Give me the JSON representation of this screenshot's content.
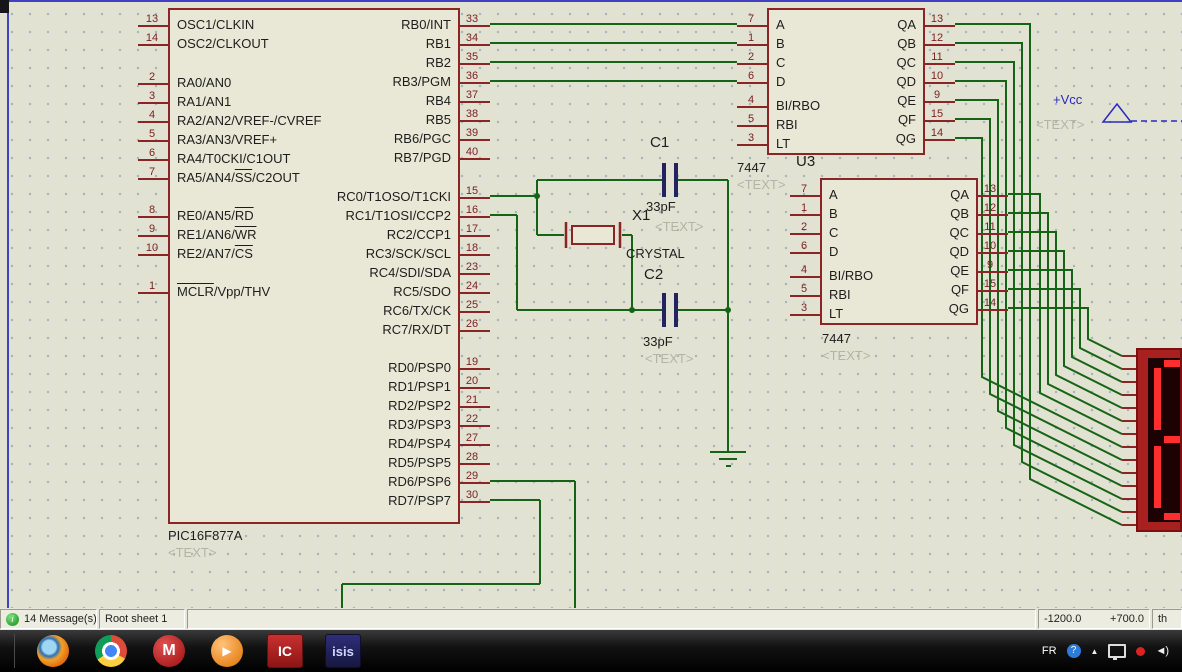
{
  "schematic": {
    "pic": {
      "value": "PIC16F877A",
      "text": "<TEXT>",
      "left_groups": [
        [
          {
            "n": "13",
            "l": [
              {
                "t": "OSC1/CLKIN"
              }
            ]
          },
          {
            "n": "14",
            "l": [
              {
                "t": "OSC2/CLKOUT"
              }
            ]
          }
        ],
        [
          {
            "n": "2",
            "l": [
              {
                "t": "RA0/AN0"
              }
            ]
          },
          {
            "n": "3",
            "l": [
              {
                "t": "RA1/AN1"
              }
            ]
          },
          {
            "n": "4",
            "l": [
              {
                "t": "RA2/AN2/VREF-/CVREF"
              }
            ]
          },
          {
            "n": "5",
            "l": [
              {
                "t": "RA3/AN3/VREF+"
              }
            ]
          },
          {
            "n": "6",
            "l": [
              {
                "t": "RA4/T0CKI/C1OUT"
              }
            ]
          },
          {
            "n": "7",
            "l": [
              {
                "t": "RA5/AN4/"
              },
              {
                "t": "SS",
                "o": true
              },
              {
                "t": "/C2OUT"
              }
            ]
          }
        ],
        [
          {
            "n": "8",
            "l": [
              {
                "t": "RE0/AN5/"
              },
              {
                "t": "RD",
                "o": true
              }
            ]
          },
          {
            "n": "9",
            "l": [
              {
                "t": "RE1/AN6/"
              },
              {
                "t": "WR",
                "o": true
              }
            ]
          },
          {
            "n": "10",
            "l": [
              {
                "t": "RE2/AN7/"
              },
              {
                "t": "CS",
                "o": true
              }
            ]
          }
        ],
        [
          {
            "n": "1",
            "l": [
              {
                "t": "MCLR",
                "o": true
              },
              {
                "t": "/Vpp/THV"
              }
            ]
          }
        ]
      ],
      "right_groups": [
        [
          {
            "n": "33",
            "l": [
              {
                "t": "RB0/INT"
              }
            ]
          },
          {
            "n": "34",
            "l": [
              {
                "t": "RB1"
              }
            ]
          },
          {
            "n": "35",
            "l": [
              {
                "t": "RB2"
              }
            ]
          },
          {
            "n": "36",
            "l": [
              {
                "t": "RB3/PGM"
              }
            ]
          },
          {
            "n": "37",
            "l": [
              {
                "t": "RB4"
              }
            ]
          },
          {
            "n": "38",
            "l": [
              {
                "t": "RB5"
              }
            ]
          },
          {
            "n": "39",
            "l": [
              {
                "t": "RB6/PGC"
              }
            ]
          },
          {
            "n": "40",
            "l": [
              {
                "t": "RB7/PGD"
              }
            ]
          }
        ],
        [
          {
            "n": "15",
            "l": [
              {
                "t": "RC0/T1OSO/T1CKI"
              }
            ]
          },
          {
            "n": "16",
            "l": [
              {
                "t": "RC1/T1OSI/CCP2"
              }
            ]
          },
          {
            "n": "17",
            "l": [
              {
                "t": "RC2/CCP1"
              }
            ]
          },
          {
            "n": "18",
            "l": [
              {
                "t": "RC3/SCK/SCL"
              }
            ]
          },
          {
            "n": "23",
            "l": [
              {
                "t": "RC4/SDI/SDA"
              }
            ]
          },
          {
            "n": "24",
            "l": [
              {
                "t": "RC5/SDO"
              }
            ]
          },
          {
            "n": "25",
            "l": [
              {
                "t": "RC6/TX/CK"
              }
            ]
          },
          {
            "n": "26",
            "l": [
              {
                "t": "RC7/RX/DT"
              }
            ]
          }
        ],
        [
          {
            "n": "19",
            "l": [
              {
                "t": "RD0/PSP0"
              }
            ]
          },
          {
            "n": "20",
            "l": [
              {
                "t": "RD1/PSP1"
              }
            ]
          },
          {
            "n": "21",
            "l": [
              {
                "t": "RD2/PSP2"
              }
            ]
          },
          {
            "n": "22",
            "l": [
              {
                "t": "RD3/PSP3"
              }
            ]
          },
          {
            "n": "27",
            "l": [
              {
                "t": "RD4/PSP4"
              }
            ]
          },
          {
            "n": "28",
            "l": [
              {
                "t": "RD5/PSP5"
              }
            ]
          },
          {
            "n": "29",
            "l": [
              {
                "t": "RD6/PSP6"
              }
            ]
          },
          {
            "n": "30",
            "l": [
              {
                "t": "RD7/PSP7"
              }
            ]
          }
        ]
      ]
    },
    "u2": {
      "value": "7447",
      "text": "<TEXT>",
      "in_groups": [
        [
          {
            "n": "7",
            "l": [
              {
                "t": "A"
              }
            ]
          },
          {
            "n": "1",
            "l": [
              {
                "t": "B"
              }
            ]
          },
          {
            "n": "2",
            "l": [
              {
                "t": "C"
              }
            ]
          },
          {
            "n": "6",
            "l": [
              {
                "t": "D"
              }
            ]
          }
        ],
        [
          {
            "n": "4",
            "l": [
              {
                "t": "BI/RBO"
              }
            ]
          },
          {
            "n": "5",
            "l": [
              {
                "t": "RBI"
              }
            ]
          },
          {
            "n": "3",
            "l": [
              {
                "t": "LT"
              }
            ]
          }
        ]
      ],
      "out_groups": [
        [
          {
            "n": "13",
            "l": [
              {
                "t": "QA"
              }
            ]
          },
          {
            "n": "12",
            "l": [
              {
                "t": "QB"
              }
            ]
          },
          {
            "n": "11",
            "l": [
              {
                "t": "QC"
              }
            ]
          },
          {
            "n": "10",
            "l": [
              {
                "t": "QD"
              }
            ]
          },
          {
            "n": "9",
            "l": [
              {
                "t": "QE"
              }
            ]
          },
          {
            "n": "15",
            "l": [
              {
                "t": "QF"
              }
            ]
          },
          {
            "n": "14",
            "l": [
              {
                "t": "QG"
              }
            ]
          }
        ]
      ]
    },
    "u3": {
      "ref": "U3",
      "value": "7447",
      "text": "<TEXT>",
      "in_groups": [
        [
          {
            "n": "7",
            "l": [
              {
                "t": "A"
              }
            ]
          },
          {
            "n": "1",
            "l": [
              {
                "t": "B"
              }
            ]
          },
          {
            "n": "2",
            "l": [
              {
                "t": "C"
              }
            ]
          },
          {
            "n": "6",
            "l": [
              {
                "t": "D"
              }
            ]
          }
        ],
        [
          {
            "n": "4",
            "l": [
              {
                "t": "BI/RBO"
              }
            ]
          },
          {
            "n": "5",
            "l": [
              {
                "t": "RBI"
              }
            ]
          },
          {
            "n": "3",
            "l": [
              {
                "t": "LT"
              }
            ]
          }
        ]
      ],
      "out_groups": [
        [
          {
            "n": "13",
            "l": [
              {
                "t": "QA"
              }
            ]
          },
          {
            "n": "12",
            "l": [
              {
                "t": "QB"
              }
            ]
          },
          {
            "n": "11",
            "l": [
              {
                "t": "QC"
              }
            ]
          },
          {
            "n": "10",
            "l": [
              {
                "t": "QD"
              }
            ]
          },
          {
            "n": "9",
            "l": [
              {
                "t": "QE"
              }
            ]
          },
          {
            "n": "15",
            "l": [
              {
                "t": "QF"
              }
            ]
          },
          {
            "n": "14",
            "l": [
              {
                "t": "QG"
              }
            ]
          }
        ]
      ]
    },
    "x1": {
      "ref": "X1",
      "value": "CRYSTAL"
    },
    "c1": {
      "ref": "C1",
      "value": "33pF",
      "text": "<TEXT>"
    },
    "c2": {
      "ref": "C2",
      "value": "33pF",
      "text": "<TEXT>"
    },
    "vcc": {
      "label": "+Vcc",
      "text": "<TEXT>"
    }
  },
  "status_bar": {
    "info_icon": "i",
    "messages": "14 Message(s)",
    "sheet": "Root sheet 1",
    "coord_x": "-1200.0",
    "coord_y": "+700.0",
    "units": "th"
  },
  "taskbar": {
    "icons": [
      {
        "name": "firefox"
      },
      {
        "name": "chrome"
      },
      {
        "name": "mcafee",
        "letter": "M"
      },
      {
        "name": "media-player",
        "glyph": "▶"
      },
      {
        "name": "proteus",
        "letter": "IC"
      },
      {
        "name": "isis",
        "letter": "isis"
      }
    ],
    "tray": {
      "language": "FR",
      "help": "?",
      "expand": "▲",
      "volume": "◄)"
    }
  }
}
